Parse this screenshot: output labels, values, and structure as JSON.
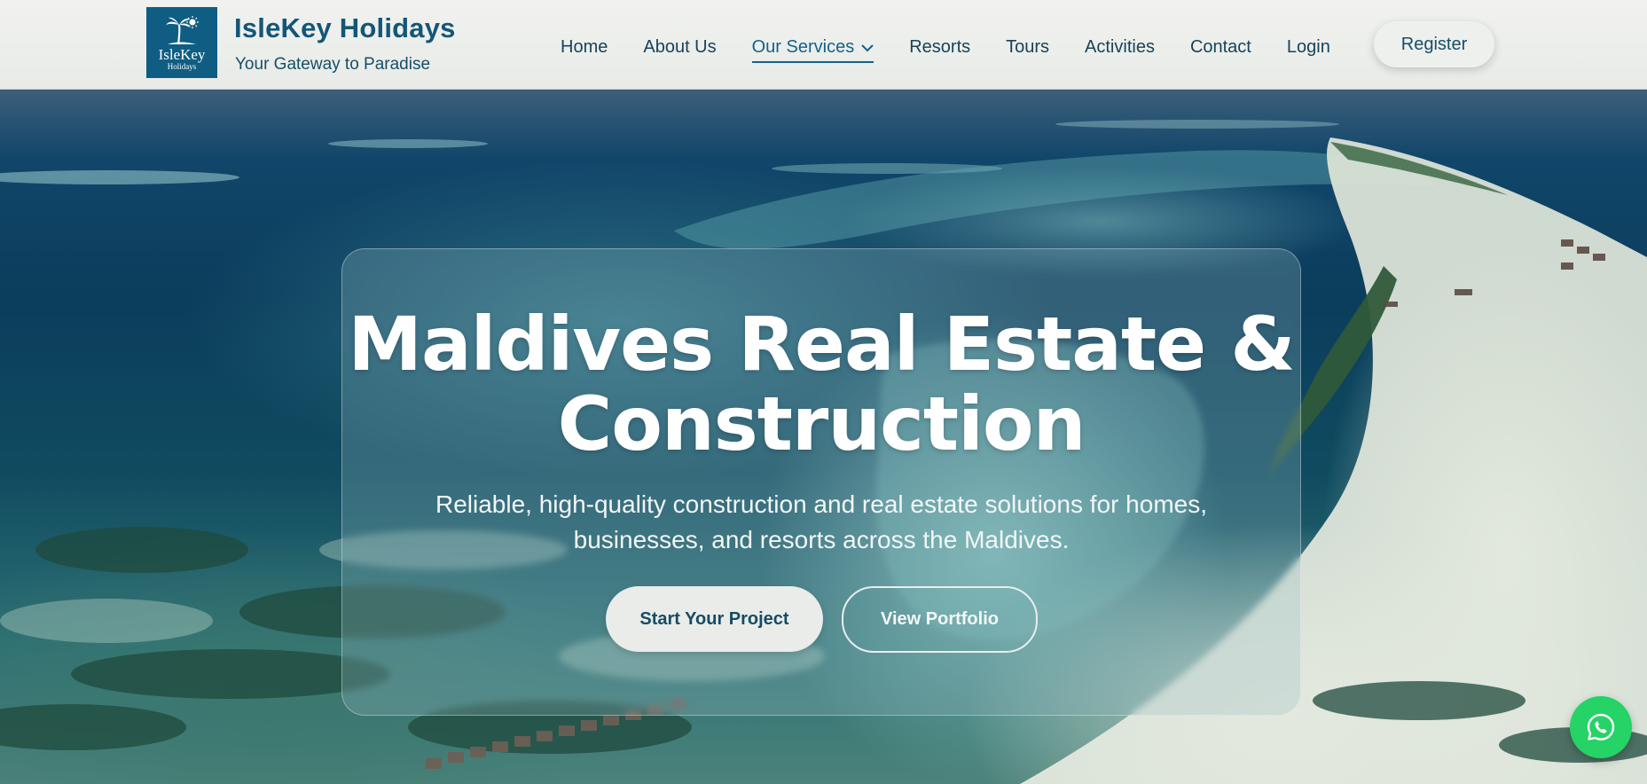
{
  "brand": {
    "logo_word": "IsleKey",
    "logo_sub": "Holidays",
    "title": "IsleKey Holidays",
    "tagline": "Your Gateway to Paradise"
  },
  "nav": {
    "items": [
      {
        "label": "Home"
      },
      {
        "label": "About Us"
      },
      {
        "label": "Our Services",
        "active": true
      },
      {
        "label": "Resorts"
      },
      {
        "label": "Tours"
      },
      {
        "label": "Activities"
      },
      {
        "label": "Contact"
      },
      {
        "label": "Login"
      }
    ],
    "register_label": "Register"
  },
  "hero": {
    "title_line1": "Maldives Real Estate &",
    "title_line2": "Construction",
    "subtitle_line1": "Reliable, high-quality construction and real estate solutions for homes,",
    "subtitle_line2": "businesses, and resorts across the Maldives.",
    "primary_cta": "Start Your Project",
    "secondary_cta": "View Portfolio"
  },
  "floating": {
    "icon": "whatsapp-icon"
  },
  "colors": {
    "brand_blue": "#135677",
    "header_bg": "#eef0ee",
    "whatsapp_green": "#25d366",
    "logo_bg": "#0f5d83"
  }
}
